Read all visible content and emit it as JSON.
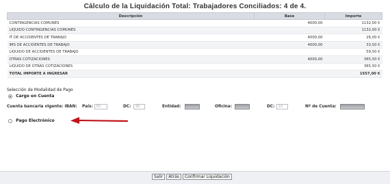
{
  "title": "Cálculo de la Liquidación Total: Trabajadores Conciliados: 4 de 4.",
  "table": {
    "headers": [
      "Descripción",
      "Base",
      "Importe"
    ],
    "rows": [
      {
        "desc": "CONTINGENCIAS COMUNES",
        "base": "4000,00",
        "importe": "1132,00 €"
      },
      {
        "desc": "LIQUIDO CONTINGENCIAS COMUNES",
        "base": "",
        "importe": "1132,00 €"
      },
      {
        "desc": "IT DE ACCIDENTES DE TRABAJO",
        "base": "4000,00",
        "importe": "26,00 €"
      },
      {
        "desc": "IMS DE ACCIDENTES DE TRABAJO",
        "base": "4000,00",
        "importe": "33,50 €"
      },
      {
        "desc": "LIQUIDO DE ACCIDENTES DE TRABAJO",
        "base": "",
        "importe": "59,50 €"
      },
      {
        "desc": "OTRAS COTIZACIONES",
        "base": "4000,00",
        "importe": "365,50 €"
      },
      {
        "desc": "LIQUIDO DE OTRAS COTIZACIONES",
        "base": "",
        "importe": "365,50 €"
      },
      {
        "desc": "TOTAL IMPORTE A INGRESAR",
        "base": "",
        "importe": "1557,00 €"
      }
    ]
  },
  "payment": {
    "section_label": "Selección de Modalidad de Pago",
    "option_account": "Cargo en Cuenta",
    "option_electronic": "Pago Electrónico",
    "selected": "Cargo en Cuenta"
  },
  "iban": {
    "label": "Cuenta bancaria vigente: IBAN:",
    "pais_label": "País:",
    "pais_placeholder": "ES",
    "dc_label": "DC:",
    "dc_placeholder": "96",
    "entidad_label": "Entidad:",
    "oficina_label": "Oficina:",
    "dc2_label": "DC:",
    "dc2_placeholder": "10",
    "cuenta_label": "Nº de Cuenta:"
  },
  "arrow_color": "#c0141b",
  "buttons": {
    "salir": "Salir",
    "atras": "Atrás",
    "confirmar": "Confirmar Liquidación"
  }
}
